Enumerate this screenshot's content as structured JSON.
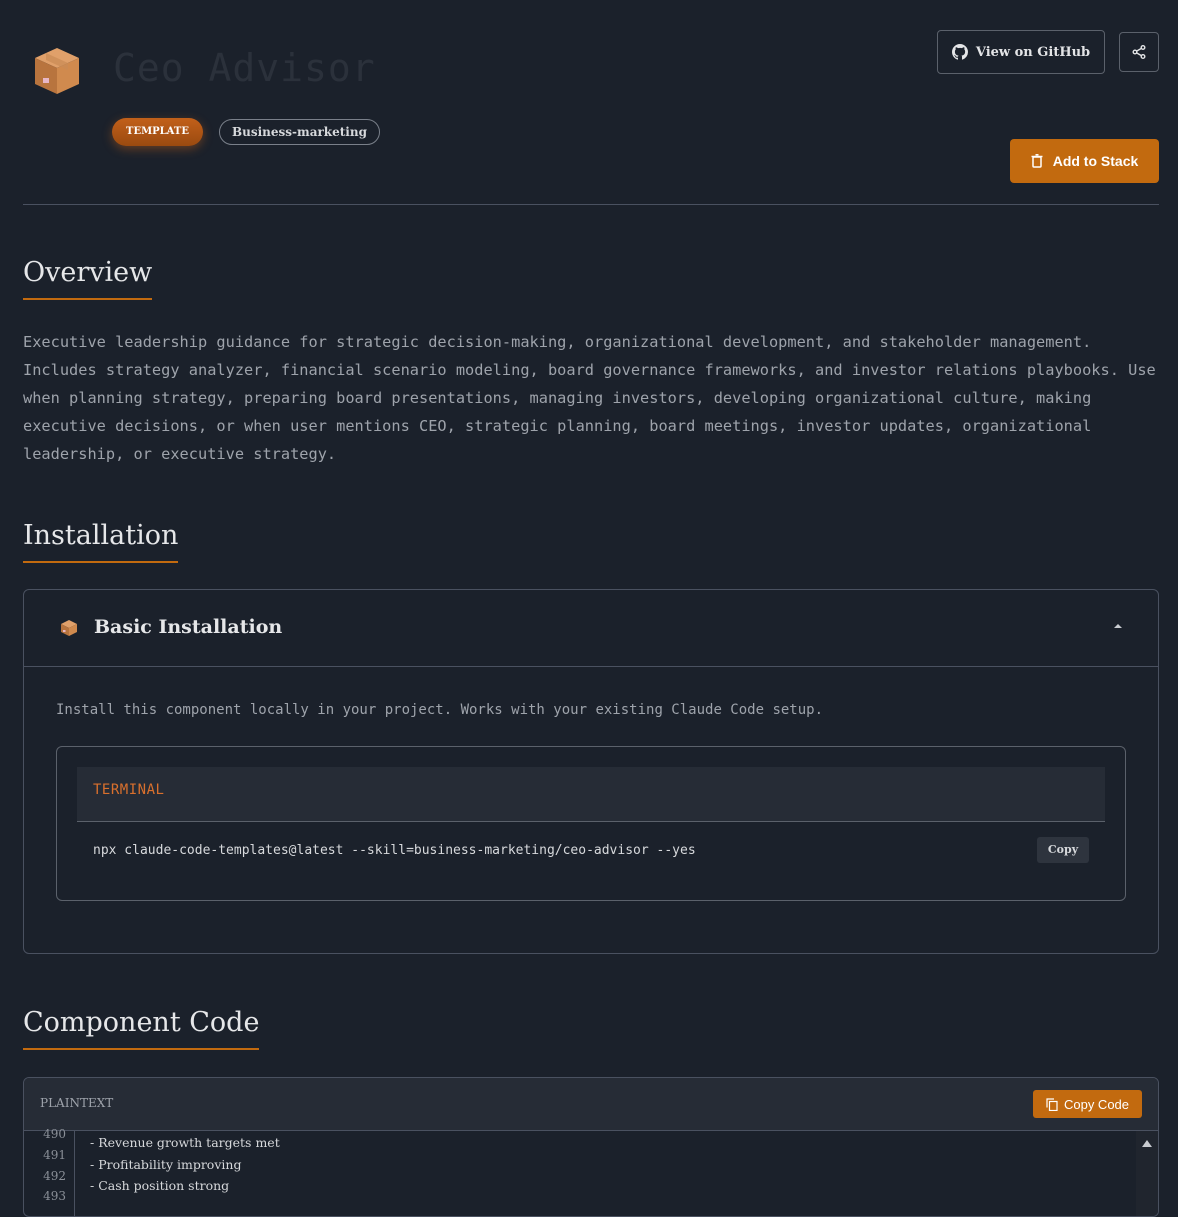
{
  "header": {
    "title": "Ceo Advisor",
    "tag_type": "TEMPLATE",
    "tag_category": "Business-marketing",
    "github_label": "View on GitHub",
    "add_label": "Add to Stack"
  },
  "overview": {
    "heading": "Overview",
    "text": "Executive leadership guidance for strategic decision-making, organizational development, and stakeholder management. Includes strategy analyzer, financial scenario modeling, board governance frameworks, and investor relations playbooks. Use when planning strategy, preparing board presentations, managing investors, developing organizational culture, making executive decisions, or when user mentions CEO, strategic planning, board meetings, investor updates, organizational leadership, or executive strategy."
  },
  "installation": {
    "heading": "Installation",
    "card_title": "Basic Installation",
    "description": "Install this component locally in your project. Works with your existing Claude Code setup.",
    "terminal_label": "TERMINAL",
    "command": "npx claude-code-templates@latest --skill=business-marketing/ceo-advisor --yes",
    "copy_label": "Copy"
  },
  "component_code": {
    "heading": "Component Code",
    "language": "PLAINTEXT",
    "copy_label": "Copy Code",
    "lines": [
      {
        "num": "490",
        "text": ""
      },
      {
        "num": "491",
        "text": "- Revenue growth targets met"
      },
      {
        "num": "492",
        "text": "- Profitability improving"
      },
      {
        "num": "493",
        "text": "- Cash position strong"
      }
    ]
  },
  "colors": {
    "accent": "#c26a0f",
    "background": "#1b212b"
  }
}
